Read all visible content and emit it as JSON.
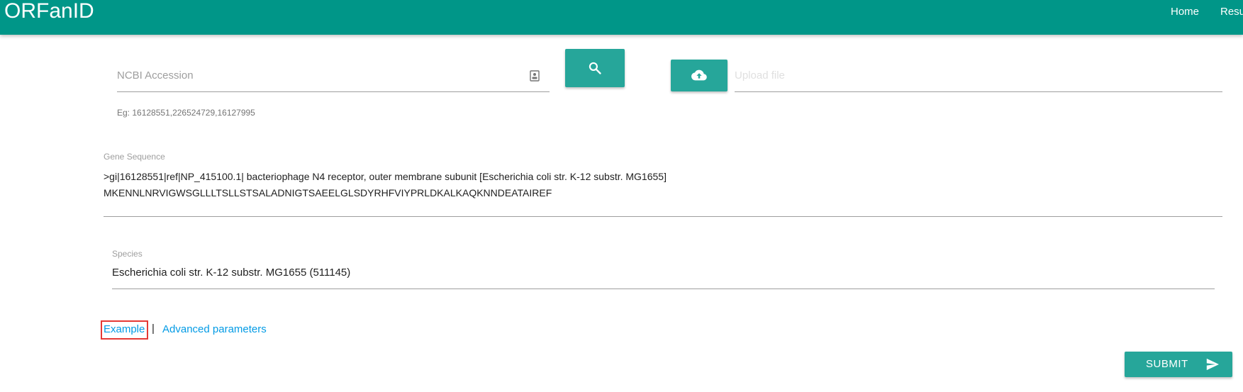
{
  "header": {
    "brand": "ORFanID",
    "nav": [
      {
        "label": "Home"
      },
      {
        "label": "Resu"
      }
    ],
    "bar_color": "#009688"
  },
  "accession": {
    "placeholder": "NCBI Accession",
    "hint": "Eg: 16128551,226524729,16127995",
    "icon": "contact-card-icon",
    "search_icon": "search-icon"
  },
  "upload": {
    "icon": "cloud-upload-icon",
    "placeholder": "Upload file"
  },
  "gene": {
    "label": "Gene Sequence",
    "value": ">gi|16128551|ref|NP_415100.1| bacteriophage N4 receptor, outer membrane subunit [Escherichia coli str. K-12 substr. MG1655]\nMKENNLNRVIGWSGLLLTSLLSTSALADNIGTSAEELGLSDYRHFVIYPRLDKALKAQKNNDEATAIREF"
  },
  "species": {
    "label": "Species",
    "value": "Escherichia coli str. K-12 substr. MG1655 (511145)"
  },
  "links": {
    "example": "Example",
    "separator": "|",
    "advanced": "Advanced parameters"
  },
  "submit": {
    "label": "SUBMIT",
    "icon": "send-icon"
  },
  "colors": {
    "accent": "#26a69a",
    "link": "#039be5",
    "highlight": "#e53935"
  }
}
